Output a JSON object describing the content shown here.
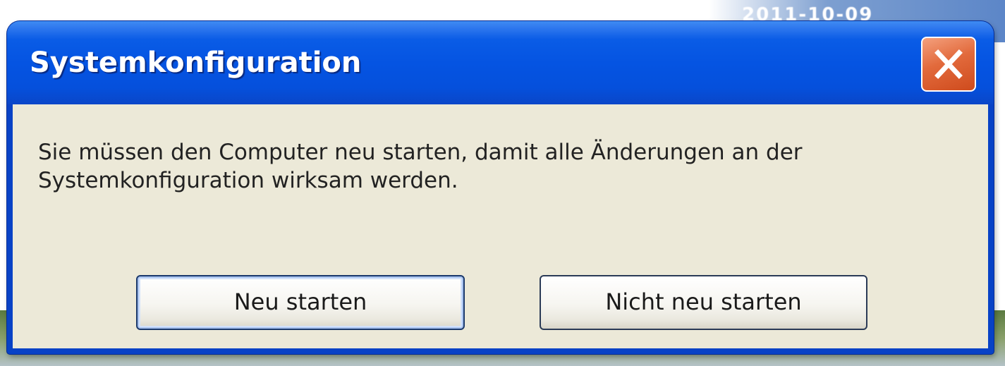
{
  "desktop": {
    "clock_text": "2011-10-09"
  },
  "dialog": {
    "title": "Systemkonfiguration",
    "close_icon": "close-icon",
    "message_line1": "Sie müssen den Computer neu starten, damit alle Änderungen an der",
    "message_line2": "Systemkonfiguration wirksam werden.",
    "buttons": {
      "restart_label": "Neu starten",
      "no_restart_label": "Nicht neu starten"
    }
  },
  "colors": {
    "titlebar_blue": "#0554e2",
    "client_background": "#ece9d8",
    "close_button": "#e26a3c"
  }
}
